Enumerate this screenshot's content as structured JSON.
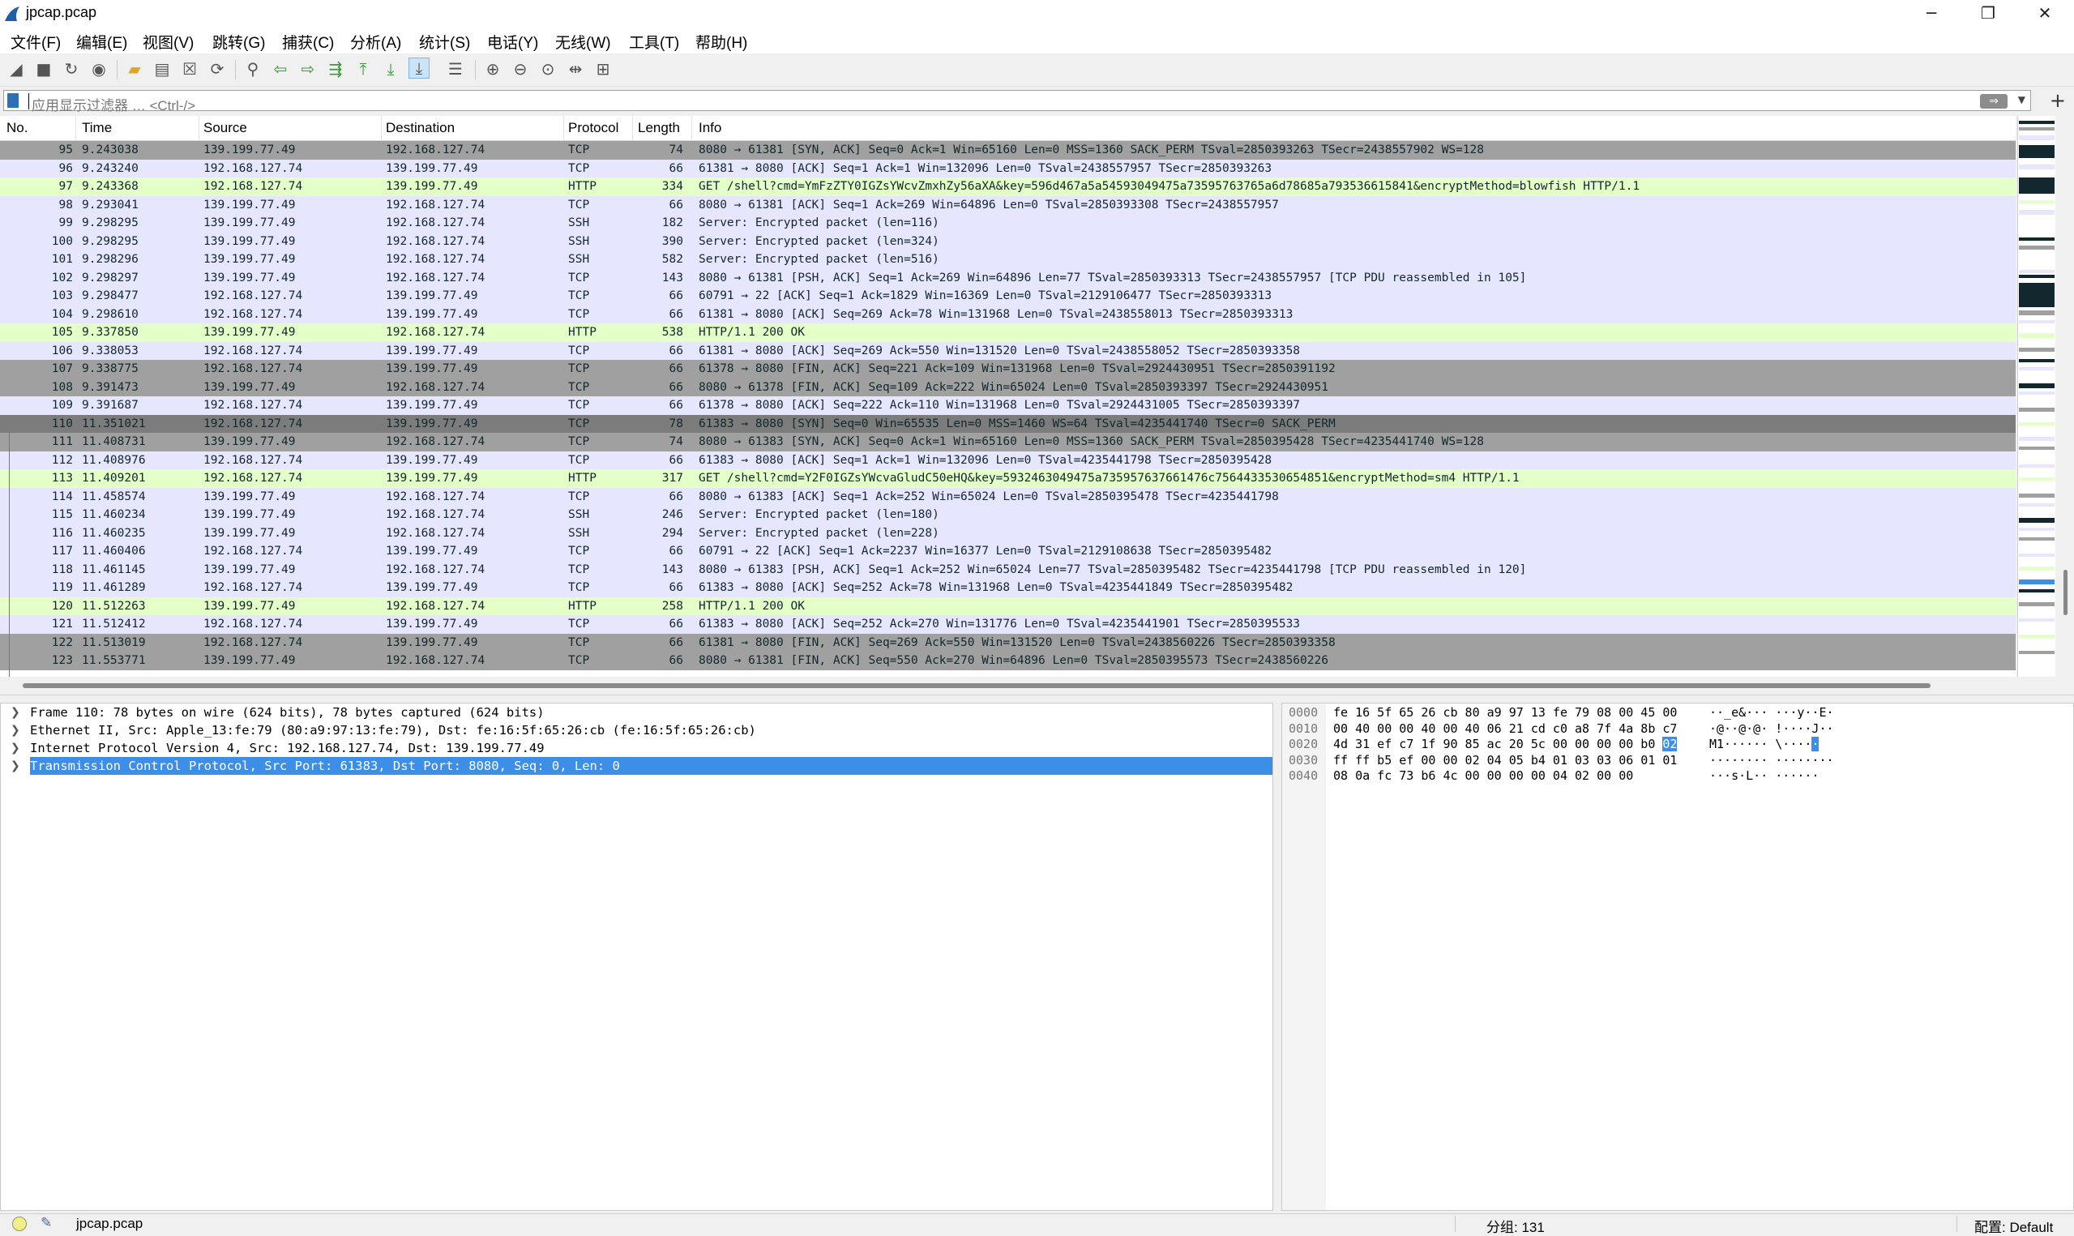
{
  "window": {
    "title": "jpcap.pcap"
  },
  "menu": [
    "文件(F)",
    "编辑(E)",
    "视图(V)",
    "跳转(G)",
    "捕获(C)",
    "分析(A)",
    "统计(S)",
    "电话(Y)",
    "无线(W)",
    "工具(T)",
    "帮助(H)"
  ],
  "filter": {
    "placeholder": "应用显示过滤器 … <Ctrl-/>"
  },
  "columns": [
    "No.",
    "Time",
    "Source",
    "Destination",
    "Protocol",
    "Length",
    "Info"
  ],
  "packets": [
    {
      "no": "95",
      "time": "9.243038",
      "src": "139.199.77.49",
      "dst": "192.168.127.74",
      "proto": "TCP",
      "len": "74",
      "info": "8080 → 61381 [SYN, ACK] Seq=0 Ack=1 Win=65160 Len=0 MSS=1360 SACK_PERM TSval=2850393263 TSecr=2438557902 WS=128",
      "style": "gray"
    },
    {
      "no": "96",
      "time": "9.243240",
      "src": "192.168.127.74",
      "dst": "139.199.77.49",
      "proto": "TCP",
      "len": "66",
      "info": "61381 → 8080 [ACK] Seq=1 Ack=1 Win=132096 Len=0 TSval=2438557957 TSecr=2850393263",
      "style": "tcp"
    },
    {
      "no": "97",
      "time": "9.243368",
      "src": "192.168.127.74",
      "dst": "139.199.77.49",
      "proto": "HTTP",
      "len": "334",
      "info": "GET /shell?cmd=YmFzZTY0IGZsYWcvZmxhZy56aXA&key=596d467a5a54593049475a73595763765a6d78685a793536615841&encryptMethod=blowfish HTTP/1.1",
      "style": "http"
    },
    {
      "no": "98",
      "time": "9.293041",
      "src": "139.199.77.49",
      "dst": "192.168.127.74",
      "proto": "TCP",
      "len": "66",
      "info": "8080 → 61381 [ACK] Seq=1 Ack=269 Win=64896 Len=0 TSval=2850393308 TSecr=2438557957",
      "style": "tcp"
    },
    {
      "no": "99",
      "time": "9.298295",
      "src": "139.199.77.49",
      "dst": "192.168.127.74",
      "proto": "SSH",
      "len": "182",
      "info": "Server: Encrypted packet (len=116)",
      "style": "ssh"
    },
    {
      "no": "100",
      "time": "9.298295",
      "src": "139.199.77.49",
      "dst": "192.168.127.74",
      "proto": "SSH",
      "len": "390",
      "info": "Server: Encrypted packet (len=324)",
      "style": "ssh"
    },
    {
      "no": "101",
      "time": "9.298296",
      "src": "139.199.77.49",
      "dst": "192.168.127.74",
      "proto": "SSH",
      "len": "582",
      "info": "Server: Encrypted packet (len=516)",
      "style": "ssh"
    },
    {
      "no": "102",
      "time": "9.298297",
      "src": "139.199.77.49",
      "dst": "192.168.127.74",
      "proto": "TCP",
      "len": "143",
      "info": "8080 → 61381 [PSH, ACK] Seq=1 Ack=269 Win=64896 Len=77 TSval=2850393313 TSecr=2438557957 [TCP PDU reassembled in 105]",
      "style": "tcp"
    },
    {
      "no": "103",
      "time": "9.298477",
      "src": "192.168.127.74",
      "dst": "139.199.77.49",
      "proto": "TCP",
      "len": "66",
      "info": "60791 → 22 [ACK] Seq=1 Ack=1829 Win=16369 Len=0 TSval=2129106477 TSecr=2850393313",
      "style": "tcp"
    },
    {
      "no": "104",
      "time": "9.298610",
      "src": "192.168.127.74",
      "dst": "139.199.77.49",
      "proto": "TCP",
      "len": "66",
      "info": "61381 → 8080 [ACK] Seq=269 Ack=78 Win=131968 Len=0 TSval=2438558013 TSecr=2850393313",
      "style": "tcp"
    },
    {
      "no": "105",
      "time": "9.337850",
      "src": "139.199.77.49",
      "dst": "192.168.127.74",
      "proto": "HTTP",
      "len": "538",
      "info": "HTTP/1.1 200 OK",
      "style": "http"
    },
    {
      "no": "106",
      "time": "9.338053",
      "src": "192.168.127.74",
      "dst": "139.199.77.49",
      "proto": "TCP",
      "len": "66",
      "info": "61381 → 8080 [ACK] Seq=269 Ack=550 Win=131520 Len=0 TSval=2438558052 TSecr=2850393358",
      "style": "tcp"
    },
    {
      "no": "107",
      "time": "9.338775",
      "src": "192.168.127.74",
      "dst": "139.199.77.49",
      "proto": "TCP",
      "len": "66",
      "info": "61378 → 8080 [FIN, ACK] Seq=221 Ack=109 Win=131968 Len=0 TSval=2924430951 TSecr=2850391192",
      "style": "gray"
    },
    {
      "no": "108",
      "time": "9.391473",
      "src": "139.199.77.49",
      "dst": "192.168.127.74",
      "proto": "TCP",
      "len": "66",
      "info": "8080 → 61378 [FIN, ACK] Seq=109 Ack=222 Win=65024 Len=0 TSval=2850393397 TSecr=2924430951",
      "style": "gray"
    },
    {
      "no": "109",
      "time": "9.391687",
      "src": "192.168.127.74",
      "dst": "139.199.77.49",
      "proto": "TCP",
      "len": "66",
      "info": "61378 → 8080 [ACK] Seq=222 Ack=110 Win=131968 Len=0 TSval=2924431005 TSecr=2850393397",
      "style": "tcp"
    },
    {
      "no": "110",
      "time": "11.351021",
      "src": "192.168.127.74",
      "dst": "139.199.77.49",
      "proto": "TCP",
      "len": "78",
      "info": "61383 → 8080 [SYN] Seq=0 Win=65535 Len=0 MSS=1460 WS=64 TSval=4235441740 TSecr=0 SACK_PERM",
      "style": "sel"
    },
    {
      "no": "111",
      "time": "11.408731",
      "src": "139.199.77.49",
      "dst": "192.168.127.74",
      "proto": "TCP",
      "len": "74",
      "info": "8080 → 61383 [SYN, ACK] Seq=0 Ack=1 Win=65160 Len=0 MSS=1360 SACK_PERM TSval=2850395428 TSecr=4235441740 WS=128",
      "style": "gray"
    },
    {
      "no": "112",
      "time": "11.408976",
      "src": "192.168.127.74",
      "dst": "139.199.77.49",
      "proto": "TCP",
      "len": "66",
      "info": "61383 → 8080 [ACK] Seq=1 Ack=1 Win=132096 Len=0 TSval=4235441798 TSecr=2850395428",
      "style": "tcp"
    },
    {
      "no": "113",
      "time": "11.409201",
      "src": "192.168.127.74",
      "dst": "139.199.77.49",
      "proto": "HTTP",
      "len": "317",
      "info": "GET /shell?cmd=Y2F0IGZsYWcvaGludC50eHQ&key=5932463049475a735957637661476c7564433530654851&encryptMethod=sm4 HTTP/1.1",
      "style": "http"
    },
    {
      "no": "114",
      "time": "11.458574",
      "src": "139.199.77.49",
      "dst": "192.168.127.74",
      "proto": "TCP",
      "len": "66",
      "info": "8080 → 61383 [ACK] Seq=1 Ack=252 Win=65024 Len=0 TSval=2850395478 TSecr=4235441798",
      "style": "tcp"
    },
    {
      "no": "115",
      "time": "11.460234",
      "src": "139.199.77.49",
      "dst": "192.168.127.74",
      "proto": "SSH",
      "len": "246",
      "info": "Server: Encrypted packet (len=180)",
      "style": "ssh"
    },
    {
      "no": "116",
      "time": "11.460235",
      "src": "139.199.77.49",
      "dst": "192.168.127.74",
      "proto": "SSH",
      "len": "294",
      "info": "Server: Encrypted packet (len=228)",
      "style": "ssh"
    },
    {
      "no": "117",
      "time": "11.460406",
      "src": "192.168.127.74",
      "dst": "139.199.77.49",
      "proto": "TCP",
      "len": "66",
      "info": "60791 → 22 [ACK] Seq=1 Ack=2237 Win=16377 Len=0 TSval=2129108638 TSecr=2850395482",
      "style": "tcp"
    },
    {
      "no": "118",
      "time": "11.461145",
      "src": "139.199.77.49",
      "dst": "192.168.127.74",
      "proto": "TCP",
      "len": "143",
      "info": "8080 → 61383 [PSH, ACK] Seq=1 Ack=252 Win=65024 Len=77 TSval=2850395482 TSecr=4235441798 [TCP PDU reassembled in 120]",
      "style": "tcp"
    },
    {
      "no": "119",
      "time": "11.461289",
      "src": "192.168.127.74",
      "dst": "139.199.77.49",
      "proto": "TCP",
      "len": "66",
      "info": "61383 → 8080 [ACK] Seq=252 Ack=78 Win=131968 Len=0 TSval=4235441849 TSecr=2850395482",
      "style": "tcp"
    },
    {
      "no": "120",
      "time": "11.512263",
      "src": "139.199.77.49",
      "dst": "192.168.127.74",
      "proto": "HTTP",
      "len": "258",
      "info": "HTTP/1.1 200 OK",
      "style": "http"
    },
    {
      "no": "121",
      "time": "11.512412",
      "src": "192.168.127.74",
      "dst": "139.199.77.49",
      "proto": "TCP",
      "len": "66",
      "info": "61383 → 8080 [ACK] Seq=252 Ack=270 Win=131776 Len=0 TSval=4235441901 TSecr=2850395533",
      "style": "tcp"
    },
    {
      "no": "122",
      "time": "11.513019",
      "src": "192.168.127.74",
      "dst": "139.199.77.49",
      "proto": "TCP",
      "len": "66",
      "info": "61381 → 8080 [FIN, ACK] Seq=269 Ack=550 Win=131520 Len=0 TSval=2438560226 TSecr=2850393358",
      "style": "gray"
    },
    {
      "no": "123",
      "time": "11.553771",
      "src": "139.199.77.49",
      "dst": "192.168.127.74",
      "proto": "TCP",
      "len": "66",
      "info": "8080 → 61381 [FIN, ACK] Seq=550 Ack=270 Win=64896 Len=0 TSval=2850395573 TSecr=2438560226",
      "style": "gray"
    }
  ],
  "details": [
    "Frame 110: 78 bytes on wire (624 bits), 78 bytes captured (624 bits)",
    "Ethernet II, Src: Apple_13:fe:79 (80:a9:97:13:fe:79), Dst: fe:16:5f:65:26:cb (fe:16:5f:65:26:cb)",
    "Internet Protocol Version 4, Src: 192.168.127.74, Dst: 139.199.77.49",
    "Transmission Control Protocol, Src Port: 61383, Dst Port: 8080, Seq: 0, Len: 0"
  ],
  "hex": [
    {
      "off": "0000",
      "hex": "fe 16 5f 65 26 cb 80 a9  97 13 fe 79 08 00 45 00",
      "asc": "··_e&··· ···y··E·"
    },
    {
      "off": "0010",
      "hex": "00 40 00 00 40 00 40 06  21 cd c0 a8 7f 4a 8b c7",
      "asc": "·@··@·@· !····J··"
    },
    {
      "off": "0020",
      "hex_pre": "4d 31 ef c7 1f 90 85 ac  20 5c 00 00 00 00 b0 ",
      "hex_hl": "02",
      "asc_pre": "M1······  \\····",
      "asc_hl": "·"
    },
    {
      "off": "0030",
      "hex": "ff ff b5 ef 00 00 02 04  05 b4 01 03 03 06 01 01",
      "asc": "········ ········"
    },
    {
      "off": "0040",
      "hex": "08 0a fc 73 b6 4c 00 00  00 00 04 02 00 00",
      "asc": "···s·L·· ······"
    }
  ],
  "status": {
    "file": "jpcap.pcap",
    "packets": "分组: 131",
    "profile": "配置: Default"
  }
}
